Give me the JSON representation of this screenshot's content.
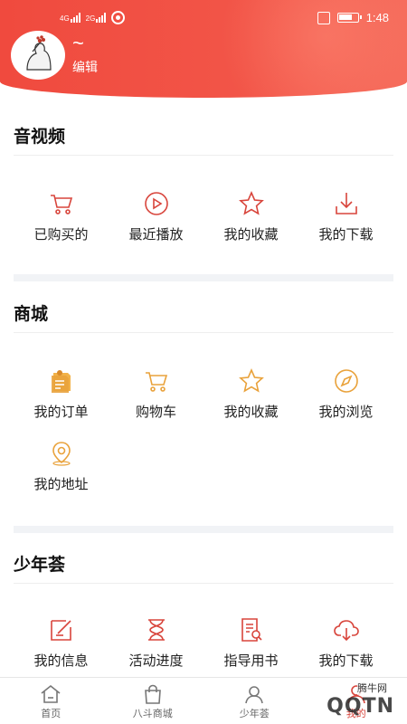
{
  "status_bar": {
    "sim1": "4G",
    "sim2": "2G",
    "time": "1:48"
  },
  "profile": {
    "nickname": "~",
    "edit_label": "编辑"
  },
  "sections": {
    "av": {
      "title": "音视频",
      "items": [
        {
          "label": "已购买的",
          "icon": "cart-icon"
        },
        {
          "label": "最近播放",
          "icon": "play-icon"
        },
        {
          "label": "我的收藏",
          "icon": "star-icon"
        },
        {
          "label": "我的下载",
          "icon": "download-icon"
        }
      ]
    },
    "mall": {
      "title": "商城",
      "items": [
        {
          "label": "我的订单",
          "icon": "order-icon"
        },
        {
          "label": "购物车",
          "icon": "cart-icon"
        },
        {
          "label": "我的收藏",
          "icon": "star-icon"
        },
        {
          "label": "我的浏览",
          "icon": "compass-icon"
        },
        {
          "label": "我的地址",
          "icon": "location-icon"
        }
      ]
    },
    "youth": {
      "title": "少年荟",
      "items": [
        {
          "label": "我的信息",
          "icon": "edit-icon"
        },
        {
          "label": "活动进度",
          "icon": "hourglass-icon"
        },
        {
          "label": "指导用书",
          "icon": "book-icon"
        },
        {
          "label": "我的下载",
          "icon": "cloud-download-icon"
        }
      ]
    }
  },
  "bottom_nav": [
    {
      "label": "首页",
      "icon": "home-icon"
    },
    {
      "label": "八斗商城",
      "icon": "bag-icon"
    },
    {
      "label": "少年荟",
      "icon": "youth-icon"
    },
    {
      "label": "我的",
      "icon": "user-icon"
    }
  ],
  "watermark": {
    "text": "QQTN",
    "small": "腾牛网"
  },
  "colors": {
    "header": "#f04a3e",
    "icon_red": "#d8453c",
    "icon_orange": "#e9a23b"
  }
}
